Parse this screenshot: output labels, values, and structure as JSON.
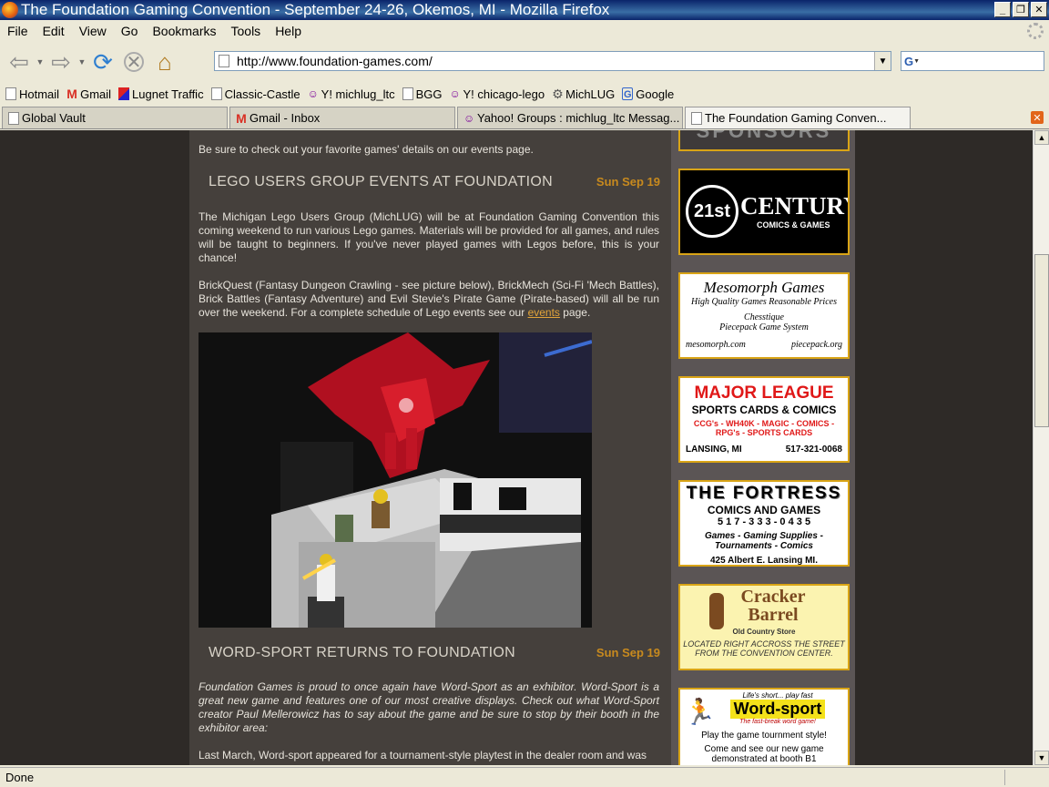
{
  "window": {
    "title": "The Foundation Gaming Convention - September 24-26, Okemos, MI - Mozilla Firefox"
  },
  "menu": [
    "File",
    "Edit",
    "View",
    "Go",
    "Bookmarks",
    "Tools",
    "Help"
  ],
  "address": {
    "url": "http://www.foundation-games.com/"
  },
  "search": {
    "value": ""
  },
  "bookmarks": [
    {
      "label": "Hotmail",
      "icon": "page-icon"
    },
    {
      "label": "Gmail",
      "icon": "gmail-icon"
    },
    {
      "label": "Lugnet Traffic",
      "icon": "lugnet-icon"
    },
    {
      "label": "Classic-Castle",
      "icon": "page-icon"
    },
    {
      "label": "Y! michlug_ltc",
      "icon": "yahoo-groups-icon"
    },
    {
      "label": "BGG",
      "icon": "page-icon"
    },
    {
      "label": "Y! chicago-lego",
      "icon": "yahoo-groups-icon"
    },
    {
      "label": "MichLUG",
      "icon": "gear-icon"
    },
    {
      "label": "Google",
      "icon": "google-icon"
    }
  ],
  "tabs": [
    {
      "label": "Global Vault",
      "icon": "page-icon",
      "active": false
    },
    {
      "label": "Gmail - Inbox",
      "icon": "gmail-icon",
      "active": false
    },
    {
      "label": "Yahoo! Groups : michlug_ltc Messag...",
      "icon": "yahoo-groups-icon",
      "active": false
    },
    {
      "label": "The Foundation Gaming Conven...",
      "icon": "page-icon",
      "active": true
    }
  ],
  "page": {
    "intro": "Be sure to check out your favorite games' details on our events page.",
    "posts": [
      {
        "title": "LEGO USERS GROUP EVENTS AT FOUNDATION",
        "date": "Sun Sep 19",
        "p1": "The Michigan Lego Users Group (MichLUG) will be at Foundation Gaming Convention this coming weekend to run various Lego games. Materials will be provided for all games, and rules will be taught to beginners. If you've never played games with Legos before, this is your chance!",
        "p2_before": "BrickQuest (Fantasy Dungeon Crawling - see picture below), BrickMech (Sci-Fi 'Mech Battles), Brick Battles (Fantasy Adventure) and Evil Stevie's Pirate Game (Pirate-based) will all be run over the weekend. For a complete schedule of Lego events see our ",
        "p2_link": "events",
        "p2_after": " page."
      },
      {
        "title": "WORD-SPORT RETURNS TO FOUNDATION",
        "date": "Sun Sep 19",
        "p1": "Foundation Games is proud to once again have Word-Sport as an exhibitor. Word-Sport is a great new game and features one of our most creative displays. Check out what Word-Sport creator Paul Mellerowicz has to say about the game and be sure to stop by their booth in the exhibitor area:",
        "p2": "Last March, Word-sport appeared for a tournament-style playtest in the dealer room and was"
      }
    ]
  },
  "sidebar": {
    "sponsors_heading": "SPONSORS",
    "ad_21st": {
      "big": "21st",
      "name": "CENTURY",
      "sub": "COMICS & GAMES"
    },
    "ad_mesomorph": {
      "name": "Mesomorph Games",
      "tagline": "High Quality Games  Reasonable Prices",
      "line1": "Chesstique",
      "line2": "Piecepack Game System",
      "url1": "mesomorph.com",
      "url2": "piecepack.org"
    },
    "ad_majorleague": {
      "name": "MAJOR LEAGUE",
      "sub": "SPORTS CARDS & COMICS",
      "line1": "CCG's - WH40K - MAGIC - COMICS -",
      "line2": "RPG's -  SPORTS CARDS",
      "city": "LANSING, MI",
      "phone": "517-321-0068"
    },
    "ad_fortress": {
      "name": "THE FORTRESS",
      "sub": "COMICS AND GAMES",
      "phone": "5 1 7 - 3 3 3 - 0 4 3 5",
      "line1": "Games - Gaming Supplies -",
      "line2": "Tournaments - Comics",
      "addr": "425 Albert   E. Lansing   MI."
    },
    "ad_cracker": {
      "name1": "Cracker",
      "name2": "Barrel",
      "sub": "Old Country Store",
      "line1": "LOCATED RIGHT ACCROSS THE STREET",
      "line2": "FROM THE CONVENTION CENTER."
    },
    "ad_wordsport": {
      "tag": "Life's short... play fast",
      "name": "Word-sport",
      "sub": "The fast-break word game!",
      "line1": "Play the game tournment style!",
      "line2": "Come and see our new game",
      "line3": "demonstrated at booth B1"
    }
  },
  "status": {
    "text": "Done"
  }
}
